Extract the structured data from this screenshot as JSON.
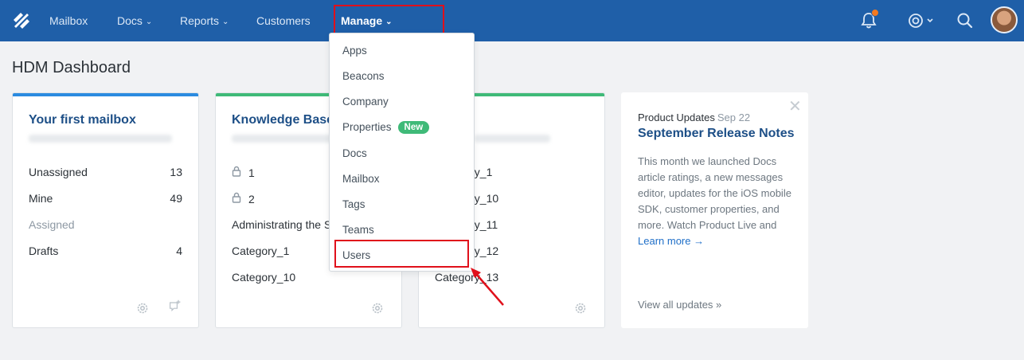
{
  "nav": {
    "items": [
      {
        "label": "Mailbox"
      },
      {
        "label": "Docs"
      },
      {
        "label": "Reports"
      },
      {
        "label": "Customers"
      },
      {
        "label": "Manage"
      }
    ],
    "icons": [
      "bell-icon",
      "help-icon",
      "search-icon",
      "avatar"
    ]
  },
  "page_title": "HDM Dashboard",
  "cards": {
    "mailbox": {
      "title": "Your first mailbox",
      "rows": [
        {
          "label": "Unassigned",
          "count": "13"
        },
        {
          "label": "Mine",
          "count": "49"
        },
        {
          "label": "Assigned",
          "count": ""
        },
        {
          "label": "Drafts",
          "count": "4"
        }
      ]
    },
    "kb": {
      "title": "Knowledge Base",
      "rows": [
        {
          "label": "1"
        },
        {
          "label": "2"
        },
        {
          "label": "Administrating the S"
        },
        {
          "label": "Category_1"
        },
        {
          "label": "Category_10"
        }
      ]
    },
    "third": {
      "rows": [
        {
          "label": "Category_1"
        },
        {
          "label": "Category_10"
        },
        {
          "label": "Category_11"
        },
        {
          "label": "Category_12"
        },
        {
          "label": "Category_13"
        }
      ]
    }
  },
  "updates": {
    "kind": "Product Updates",
    "date": "Sep 22",
    "title": "September Release Notes",
    "body": "This month we launched Docs article ratings, a new messages editor, updates for the iOS mobile SDK, customer properties, and more. Watch Product Live and ",
    "link": "Learn more →",
    "view_all": "View all updates »"
  },
  "dropdown": {
    "items": [
      {
        "label": "Apps"
      },
      {
        "label": "Beacons"
      },
      {
        "label": "Company"
      },
      {
        "label": "Properties",
        "badge": "New"
      },
      {
        "label": "Docs"
      },
      {
        "label": "Mailbox"
      },
      {
        "label": "Tags"
      },
      {
        "label": "Teams"
      },
      {
        "label": "Users"
      }
    ]
  },
  "colors": {
    "nav_bg": "#1f5fa8",
    "highlight": "#e0101b",
    "accent_blue": "#2b8be0",
    "accent_green": "#3fba78",
    "notification": "#f47a20"
  }
}
